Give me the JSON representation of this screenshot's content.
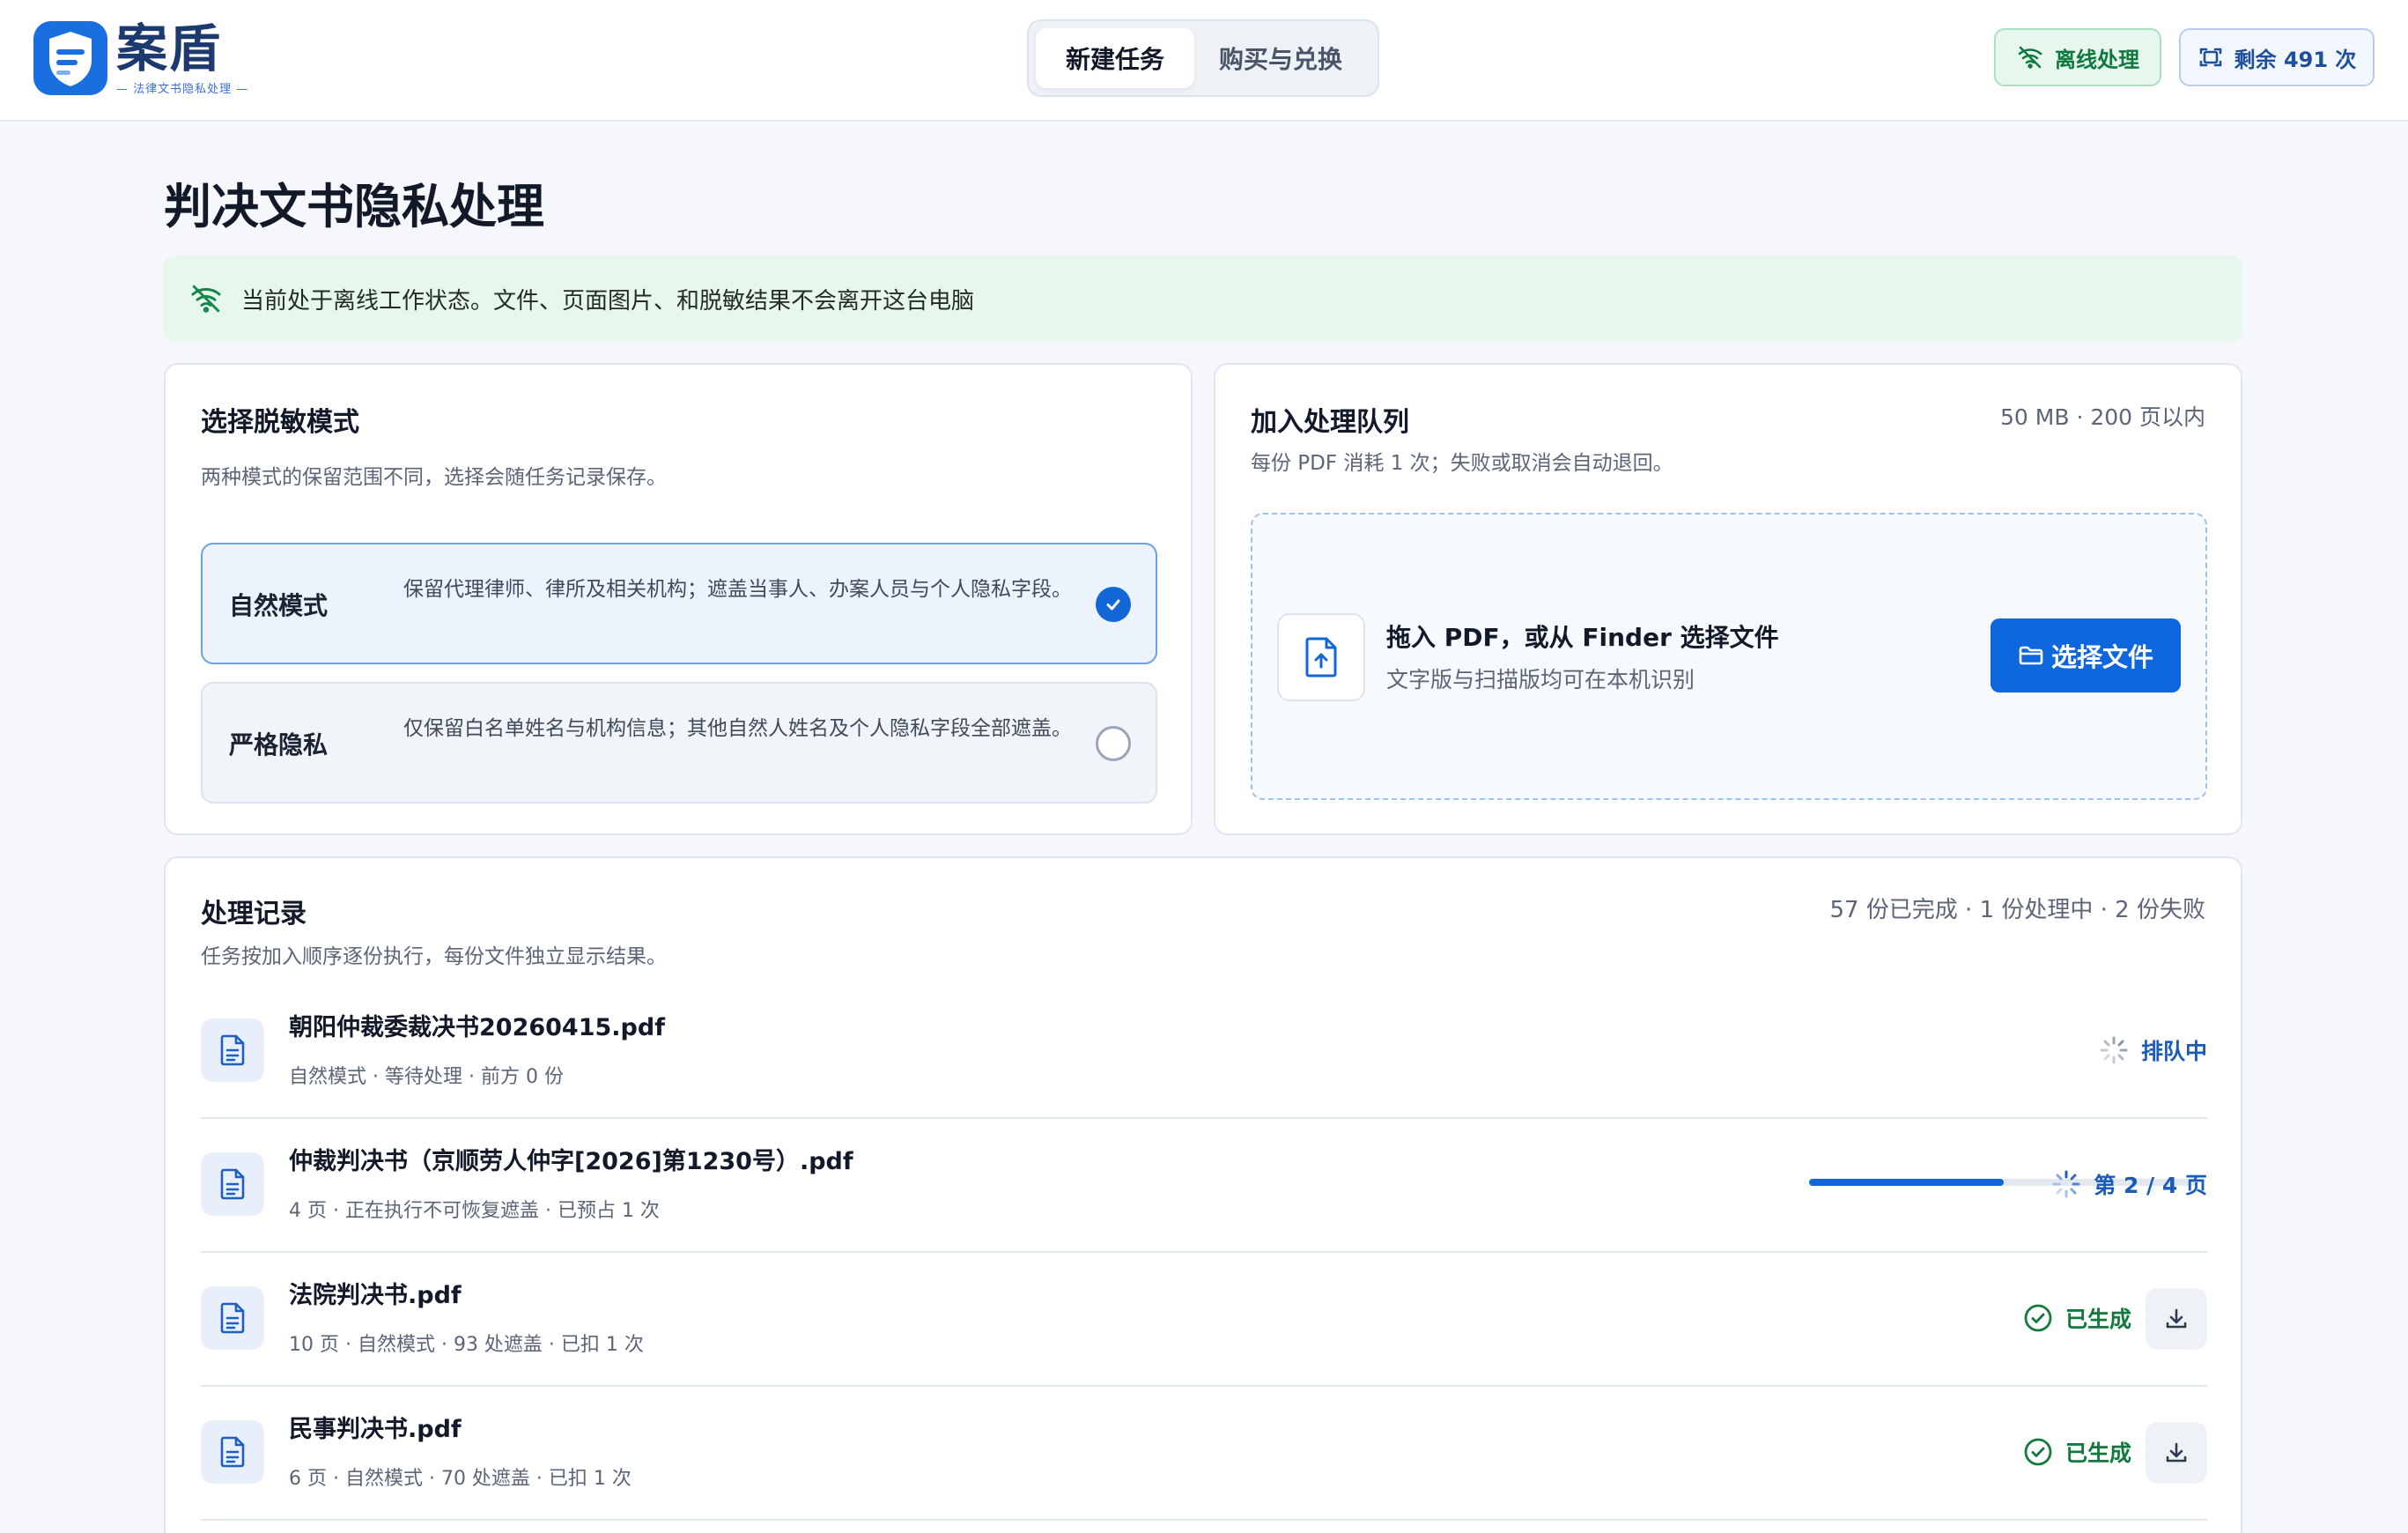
{
  "app": {
    "name": "案盾",
    "tagline": "— 法律文书隐私处理 —"
  },
  "nav": {
    "tabs": [
      {
        "label": "新建任务",
        "active": true
      },
      {
        "label": "购买与兑换",
        "active": false
      }
    ]
  },
  "header": {
    "offline_label": "离线处理",
    "remaining_label": "剩余 491 次"
  },
  "page": {
    "title": "判决文书隐私处理",
    "banner": "当前处于离线工作状态。文件、页面图片、和脱敏结果不会离开这台电脑"
  },
  "mode_card": {
    "title": "选择脱敏模式",
    "subtitle": "两种模式的保留范围不同，选择会随任务记录保存。",
    "options": [
      {
        "name": "自然模式",
        "description": "保留代理律师、律所及相关机构；遮盖当事人、办案人员与个人隐私字段。",
        "selected": true
      },
      {
        "name": "严格隐私",
        "description": "仅保留白名单姓名与机构信息；其他自然人姓名及个人隐私字段全部遮盖。",
        "selected": false
      }
    ]
  },
  "queue_card": {
    "title": "加入处理队列",
    "subtitle": "每份 PDF 消耗 1 次；失败或取消会自动退回。",
    "limit": "50 MB · 200 页以内",
    "drop_title": "拖入 PDF，或从 Finder 选择文件",
    "drop_sub": "文字版与扫描版均可在本机识别",
    "choose_button": "选择文件"
  },
  "records": {
    "title": "处理记录",
    "subtitle": "任务按加入顺序逐份执行，每份文件独立显示结果。",
    "summary": "57 份已完成 · 1 份处理中 · 2 份失败",
    "items": [
      {
        "name": "朝阳仲裁委裁决书20260415.pdf",
        "meta": "自然模式 · 等待处理 · 前方 0 份",
        "status": "排队中",
        "state": "queued"
      },
      {
        "name": "仲裁判决书（京顺劳人仲字[2026]第1230号）.pdf",
        "meta": "4 页 · 正在执行不可恢复遮盖 · 已预占 1 次",
        "status": "第 2 / 4 页",
        "state": "processing",
        "progress": 0.5
      },
      {
        "name": "法院判决书.pdf",
        "meta": "10 页 · 自然模式 · 93 处遮盖 · 已扣 1 次",
        "status": "已生成",
        "state": "done"
      },
      {
        "name": "民事判决书.pdf",
        "meta": "6 页 · 自然模式 · 70 处遮盖 · 已扣 1 次",
        "status": "已生成",
        "state": "done"
      }
    ]
  },
  "colors": {
    "primary": "#0f67de",
    "success": "#127a3c",
    "offline_bg": "#e7f7ee"
  }
}
